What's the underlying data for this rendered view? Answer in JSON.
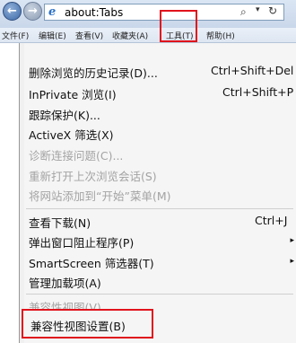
{
  "address_bar": {
    "url": "about:Tabs",
    "search_glyph": "⌕",
    "dropdown_glyph": "▾",
    "refresh_glyph": "↻"
  },
  "menu_bar": {
    "items": [
      "文件(F)",
      "编辑(E)",
      "查看(V)",
      "收藏夹(A)",
      "工具(T)",
      "帮助(H)"
    ]
  },
  "tools_menu": {
    "items": [
      {
        "label": "删除浏览的历史记录(D)...",
        "shortcut": "Ctrl+Shift+Del",
        "enabled": true
      },
      {
        "label": "InPrivate 浏览(I)",
        "shortcut": "Ctrl+Shift+P",
        "enabled": true
      },
      {
        "label": "跟踪保护(K)...",
        "enabled": true
      },
      {
        "label": "ActiveX 筛选(X)",
        "enabled": true
      },
      {
        "label": "诊断连接问题(C)...",
        "enabled": false
      },
      {
        "label": "重新打开上次浏览会话(S)",
        "enabled": false
      },
      {
        "label": "将网站添加到“开始”菜单(M)",
        "enabled": false
      },
      {
        "label": "查看下载(N)",
        "shortcut": "Ctrl+J",
        "enabled": true
      },
      {
        "label": "弹出窗口阻止程序(P)",
        "submenu": true,
        "enabled": true
      },
      {
        "label": "SmartScreen 筛选器(T)",
        "submenu": true,
        "enabled": true
      },
      {
        "label": "管理加载项(A)",
        "enabled": true
      },
      {
        "label": "兼容性视图(V)",
        "enabled": false
      },
      {
        "label": "兼容性视图设置(B)",
        "enabled": true
      }
    ],
    "submenu_arrow": "▸"
  },
  "colors": {
    "highlight_border": "#e0131c",
    "menu_background": "#f5f5f5",
    "disabled_text": "#a3a3a3",
    "chrome_blue": "#dbe6f4"
  }
}
